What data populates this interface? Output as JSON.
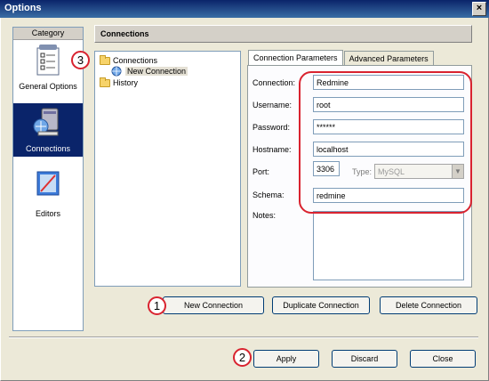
{
  "window": {
    "title": "Options"
  },
  "category": {
    "header": "Category",
    "items": [
      {
        "label": "General Options",
        "icon": "checklist-icon",
        "selected": false
      },
      {
        "label": "Connections",
        "icon": "database-connection-icon",
        "selected": true
      },
      {
        "label": "Editors",
        "icon": "editor-icon",
        "selected": false
      }
    ]
  },
  "section": {
    "title": "Connections"
  },
  "tree": {
    "root": "Connections",
    "child": "New Connection",
    "sibling": "History"
  },
  "tabs": [
    {
      "label": "Connection Parameters",
      "active": true
    },
    {
      "label": "Advanced Parameters",
      "active": false
    }
  ],
  "form": {
    "connection_label": "Connection:",
    "connection_value": "Redmine",
    "username_label": "Username:",
    "username_value": "root",
    "password_label": "Password:",
    "password_value": "******",
    "hostname_label": "Hostname:",
    "hostname_value": "localhost",
    "port_label": "Port:",
    "port_value": "3306",
    "type_label": "Type:",
    "type_value": "MySQL",
    "schema_label": "Schema:",
    "schema_value": "redmine",
    "notes_label": "Notes:"
  },
  "connection_buttons": {
    "new": "New Connection",
    "duplicate": "Duplicate Connection",
    "delete": "Delete Connection"
  },
  "dialog_buttons": {
    "apply": "Apply",
    "discard": "Discard",
    "close": "Close"
  },
  "markers": {
    "one": "1",
    "two": "2",
    "three": "3"
  },
  "colors": {
    "selection": "#0a246a",
    "annotation": "#d9232f"
  }
}
